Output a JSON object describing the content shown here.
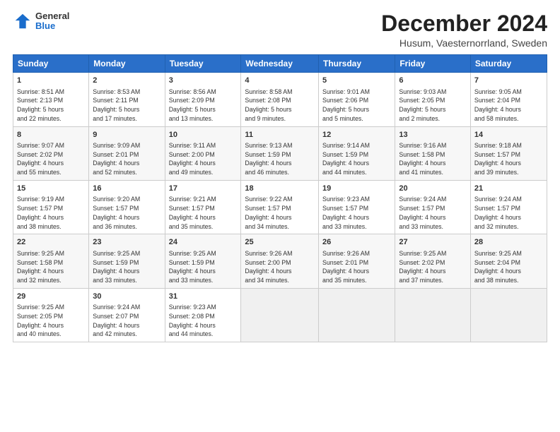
{
  "logo": {
    "general": "General",
    "blue": "Blue"
  },
  "title": "December 2024",
  "subtitle": "Husum, Vaesternorrland, Sweden",
  "days_header": [
    "Sunday",
    "Monday",
    "Tuesday",
    "Wednesday",
    "Thursday",
    "Friday",
    "Saturday"
  ],
  "weeks": [
    [
      {
        "day": "1",
        "info": "Sunrise: 8:51 AM\nSunset: 2:13 PM\nDaylight: 5 hours\nand 22 minutes."
      },
      {
        "day": "2",
        "info": "Sunrise: 8:53 AM\nSunset: 2:11 PM\nDaylight: 5 hours\nand 17 minutes."
      },
      {
        "day": "3",
        "info": "Sunrise: 8:56 AM\nSunset: 2:09 PM\nDaylight: 5 hours\nand 13 minutes."
      },
      {
        "day": "4",
        "info": "Sunrise: 8:58 AM\nSunset: 2:08 PM\nDaylight: 5 hours\nand 9 minutes."
      },
      {
        "day": "5",
        "info": "Sunrise: 9:01 AM\nSunset: 2:06 PM\nDaylight: 5 hours\nand 5 minutes."
      },
      {
        "day": "6",
        "info": "Sunrise: 9:03 AM\nSunset: 2:05 PM\nDaylight: 5 hours\nand 2 minutes."
      },
      {
        "day": "7",
        "info": "Sunrise: 9:05 AM\nSunset: 2:04 PM\nDaylight: 4 hours\nand 58 minutes."
      }
    ],
    [
      {
        "day": "8",
        "info": "Sunrise: 9:07 AM\nSunset: 2:02 PM\nDaylight: 4 hours\nand 55 minutes."
      },
      {
        "day": "9",
        "info": "Sunrise: 9:09 AM\nSunset: 2:01 PM\nDaylight: 4 hours\nand 52 minutes."
      },
      {
        "day": "10",
        "info": "Sunrise: 9:11 AM\nSunset: 2:00 PM\nDaylight: 4 hours\nand 49 minutes."
      },
      {
        "day": "11",
        "info": "Sunrise: 9:13 AM\nSunset: 1:59 PM\nDaylight: 4 hours\nand 46 minutes."
      },
      {
        "day": "12",
        "info": "Sunrise: 9:14 AM\nSunset: 1:59 PM\nDaylight: 4 hours\nand 44 minutes."
      },
      {
        "day": "13",
        "info": "Sunrise: 9:16 AM\nSunset: 1:58 PM\nDaylight: 4 hours\nand 41 minutes."
      },
      {
        "day": "14",
        "info": "Sunrise: 9:18 AM\nSunset: 1:57 PM\nDaylight: 4 hours\nand 39 minutes."
      }
    ],
    [
      {
        "day": "15",
        "info": "Sunrise: 9:19 AM\nSunset: 1:57 PM\nDaylight: 4 hours\nand 38 minutes."
      },
      {
        "day": "16",
        "info": "Sunrise: 9:20 AM\nSunset: 1:57 PM\nDaylight: 4 hours\nand 36 minutes."
      },
      {
        "day": "17",
        "info": "Sunrise: 9:21 AM\nSunset: 1:57 PM\nDaylight: 4 hours\nand 35 minutes."
      },
      {
        "day": "18",
        "info": "Sunrise: 9:22 AM\nSunset: 1:57 PM\nDaylight: 4 hours\nand 34 minutes."
      },
      {
        "day": "19",
        "info": "Sunrise: 9:23 AM\nSunset: 1:57 PM\nDaylight: 4 hours\nand 33 minutes."
      },
      {
        "day": "20",
        "info": "Sunrise: 9:24 AM\nSunset: 1:57 PM\nDaylight: 4 hours\nand 33 minutes."
      },
      {
        "day": "21",
        "info": "Sunrise: 9:24 AM\nSunset: 1:57 PM\nDaylight: 4 hours\nand 32 minutes."
      }
    ],
    [
      {
        "day": "22",
        "info": "Sunrise: 9:25 AM\nSunset: 1:58 PM\nDaylight: 4 hours\nand 32 minutes."
      },
      {
        "day": "23",
        "info": "Sunrise: 9:25 AM\nSunset: 1:59 PM\nDaylight: 4 hours\nand 33 minutes."
      },
      {
        "day": "24",
        "info": "Sunrise: 9:25 AM\nSunset: 1:59 PM\nDaylight: 4 hours\nand 33 minutes."
      },
      {
        "day": "25",
        "info": "Sunrise: 9:26 AM\nSunset: 2:00 PM\nDaylight: 4 hours\nand 34 minutes."
      },
      {
        "day": "26",
        "info": "Sunrise: 9:26 AM\nSunset: 2:01 PM\nDaylight: 4 hours\nand 35 minutes."
      },
      {
        "day": "27",
        "info": "Sunrise: 9:25 AM\nSunset: 2:02 PM\nDaylight: 4 hours\nand 37 minutes."
      },
      {
        "day": "28",
        "info": "Sunrise: 9:25 AM\nSunset: 2:04 PM\nDaylight: 4 hours\nand 38 minutes."
      }
    ],
    [
      {
        "day": "29",
        "info": "Sunrise: 9:25 AM\nSunset: 2:05 PM\nDaylight: 4 hours\nand 40 minutes."
      },
      {
        "day": "30",
        "info": "Sunrise: 9:24 AM\nSunset: 2:07 PM\nDaylight: 4 hours\nand 42 minutes."
      },
      {
        "day": "31",
        "info": "Sunrise: 9:23 AM\nSunset: 2:08 PM\nDaylight: 4 hours\nand 44 minutes."
      },
      null,
      null,
      null,
      null
    ]
  ]
}
